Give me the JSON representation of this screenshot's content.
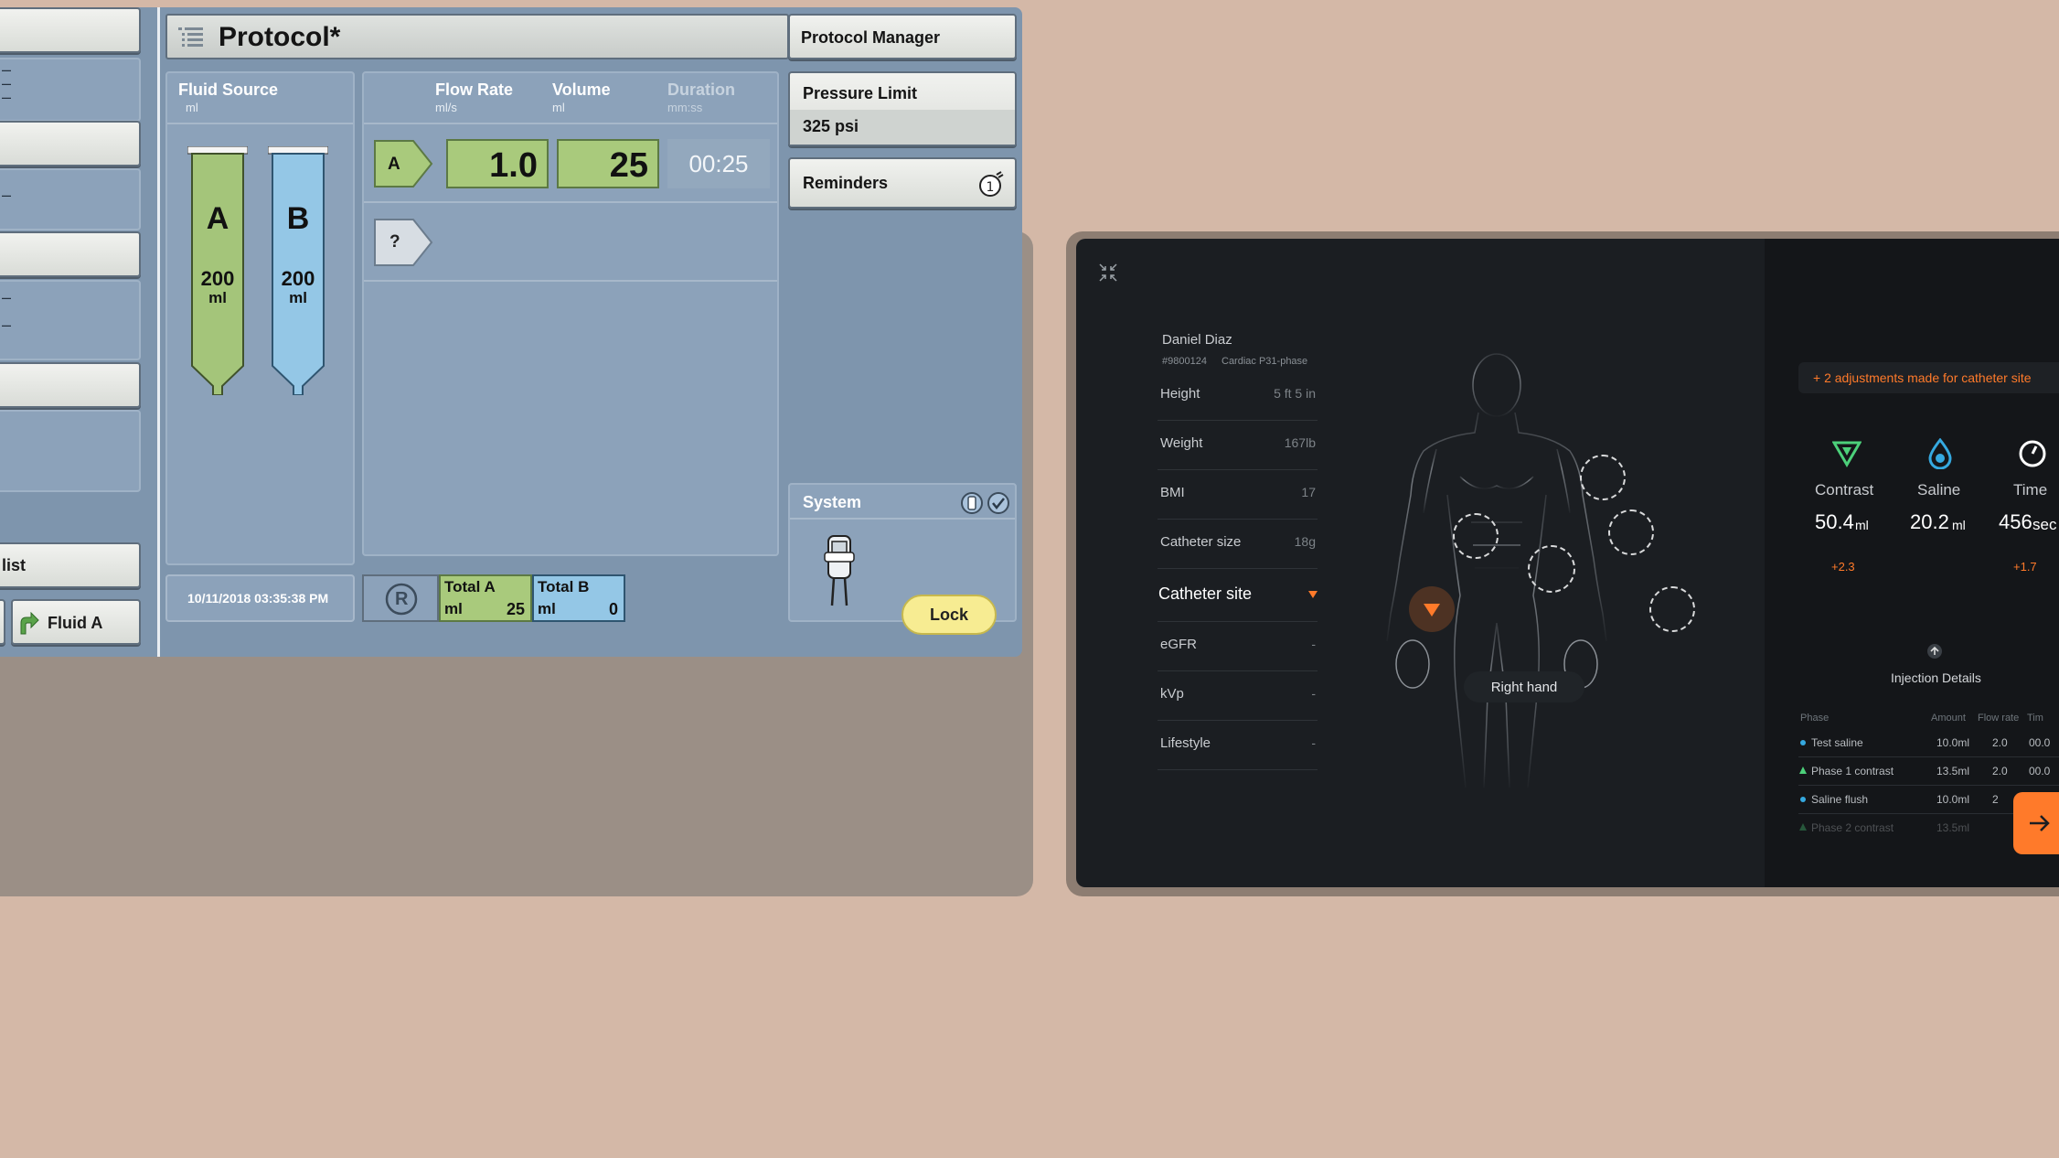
{
  "left_ui": {
    "sidebar": {
      "last_button_label": "list",
      "fluid_button_label": "Fluid A"
    },
    "header": {
      "title": "Protocol*",
      "protocol_manager_label": "Protocol Manager"
    },
    "fluid_source": {
      "title": "Fluid Source",
      "unit": "ml",
      "syringes": [
        {
          "label": "A",
          "amount": "200",
          "unit": "ml",
          "color": "#a4c57a"
        },
        {
          "label": "B",
          "amount": "200",
          "unit": "ml",
          "color": "#94c7e6"
        }
      ]
    },
    "protocol_table": {
      "columns": [
        {
          "label": "Flow Rate",
          "unit": "ml/s"
        },
        {
          "label": "Volume",
          "unit": "ml"
        },
        {
          "label": "Duration",
          "unit": "mm:ss"
        }
      ],
      "phases": [
        {
          "tag": "A",
          "flow_rate": "1.0",
          "volume": "25",
          "duration": "00:25"
        }
      ],
      "add_phase_tag": "?"
    },
    "pressure_limit": {
      "label": "Pressure Limit",
      "value": "325 psi"
    },
    "reminders": {
      "label": "Reminders"
    },
    "system": {
      "label": "System"
    },
    "timestamp": "10/11/2018 03:35:38 PM",
    "totals": {
      "r_label": "R",
      "total_a_label": "Total A",
      "total_a_unit": "ml",
      "total_a_value": "25",
      "total_b_label": "Total B",
      "total_b_unit": "ml",
      "total_b_value": "0"
    },
    "lock_label": "Lock"
  },
  "right_ui": {
    "patient": {
      "name": "Daniel Diaz",
      "id": "#9800124",
      "protocol": "Cardiac P31-phase"
    },
    "info_rows": [
      {
        "label": "Height",
        "value": "5 ft 5 in"
      },
      {
        "label": "Weight",
        "value": "167lb"
      },
      {
        "label": "BMI",
        "value": "17"
      },
      {
        "label": "Catheter size",
        "value": "18g"
      }
    ],
    "catheter_site_label": "Catheter site",
    "extra_rows": [
      {
        "label": "eGFR",
        "value": "-"
      },
      {
        "label": "kVp",
        "value": "-"
      },
      {
        "label": "Lifestyle",
        "value": "-"
      }
    ],
    "body_map": {
      "selected_site": "Right hand"
    },
    "adjustment_banner": "+ 2 adjustments made for catheter site",
    "summary": [
      {
        "label": "Contrast",
        "value": "50.4",
        "unit": "ml",
        "delta": "+2.3",
        "icon": "triangle-icon",
        "color": "#4cd07a"
      },
      {
        "label": "Saline",
        "value": "20.2",
        "unit": "ml",
        "delta": "",
        "icon": "drop-icon",
        "color": "#35a9e0"
      },
      {
        "label": "Time",
        "value": "456",
        "unit": "sec",
        "delta": "+1.7",
        "icon": "stopwatch-icon",
        "color": "#ffffff"
      }
    ],
    "injection_details_label": "Injection Details",
    "table": {
      "columns": [
        "Phase",
        "Amount",
        "Flow rate",
        "Tim"
      ],
      "rows": [
        {
          "phase": "Test saline",
          "amount": "10.0ml",
          "flow": "2.0",
          "time": "00.0"
        },
        {
          "phase": "Phase 1 contrast",
          "amount": "13.5ml",
          "flow": "2.0",
          "time": "00.0"
        },
        {
          "phase": "Saline flush",
          "amount": "10.0ml",
          "flow": "2",
          "time": ""
        },
        {
          "phase": "Phase 2 contrast",
          "amount": "13.5ml",
          "flow": "",
          "time": ""
        }
      ]
    },
    "accent_color": "#ff7a2a"
  }
}
